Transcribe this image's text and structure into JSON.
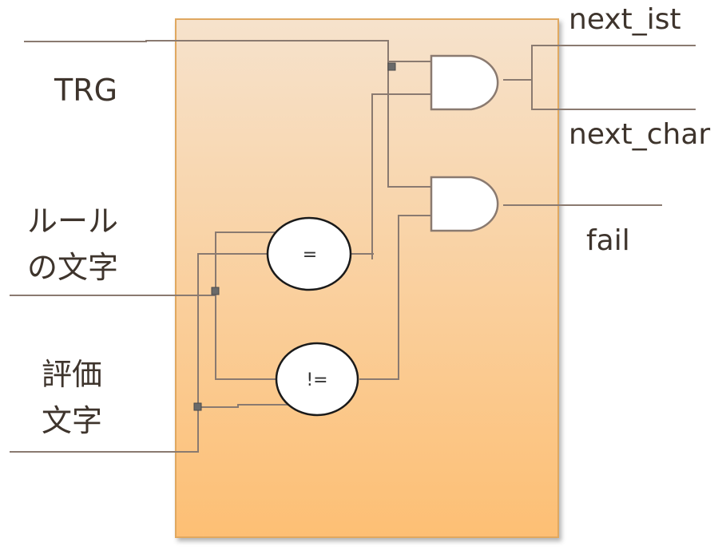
{
  "diagram": {
    "inputs": {
      "trg": "TRG",
      "rule_char_line1": "ルール",
      "rule_char_line2": "の文字",
      "eval_char_line1": "評価",
      "eval_char_line2": "文字"
    },
    "outputs": {
      "next_ist": "next_ist",
      "next_char": "next_char",
      "fail": "fail"
    },
    "operators": {
      "equal": "=",
      "not_equal": "!="
    },
    "colors": {
      "block_top": "#f6e2cc",
      "block_bottom": "#fdbf74",
      "block_border": "#e0a860",
      "wire": "#8a7a70",
      "text": "#3e342c"
    }
  }
}
